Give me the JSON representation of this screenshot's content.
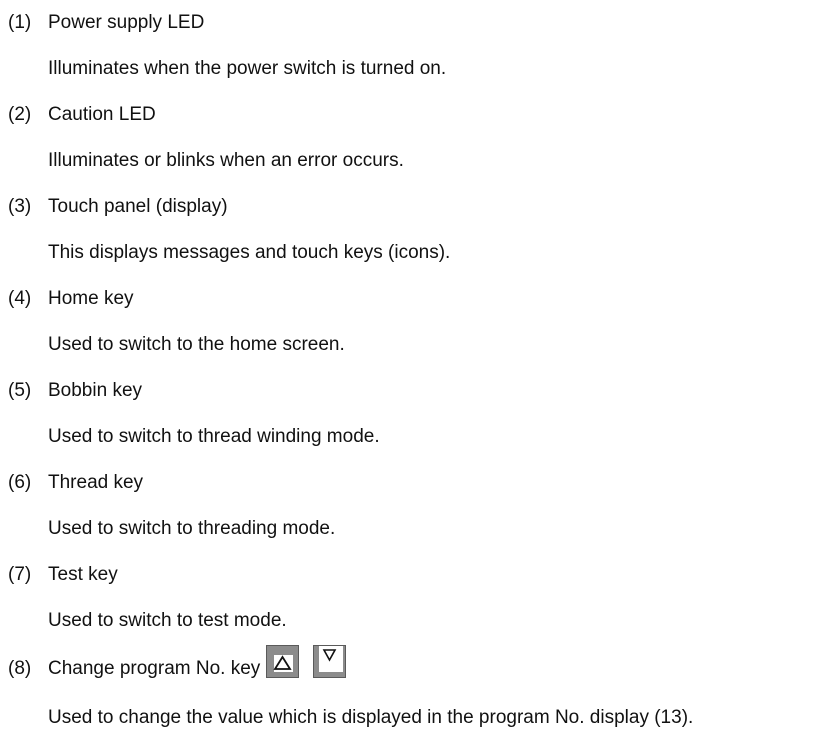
{
  "items": [
    {
      "num": "(1)",
      "title": "Power supply LED",
      "desc": "Illuminates when the power switch is turned on."
    },
    {
      "num": "(2)",
      "title": "Caution LED",
      "desc": "Illuminates or blinks when an error occurs."
    },
    {
      "num": "(3)",
      "title": "Touch panel (display)",
      "desc": "This displays messages and touch keys (icons)."
    },
    {
      "num": "(4)",
      "title": "Home key",
      "desc": "Used to switch to the home screen."
    },
    {
      "num": "(5)",
      "title": "Bobbin key",
      "desc": "Used to switch to thread winding mode."
    },
    {
      "num": "(6)",
      "title": "Thread key",
      "desc": "Used to switch to threading mode."
    },
    {
      "num": "(7)",
      "title": "Test key",
      "desc": "Used to switch to test mode."
    },
    {
      "num": "(8)",
      "title": "Change program No. key",
      "desc": "Used to change the value which is displayed in the program No. display (13)."
    }
  ],
  "icons": {
    "up": "triangle-up-icon",
    "down": "triangle-down-icon"
  }
}
